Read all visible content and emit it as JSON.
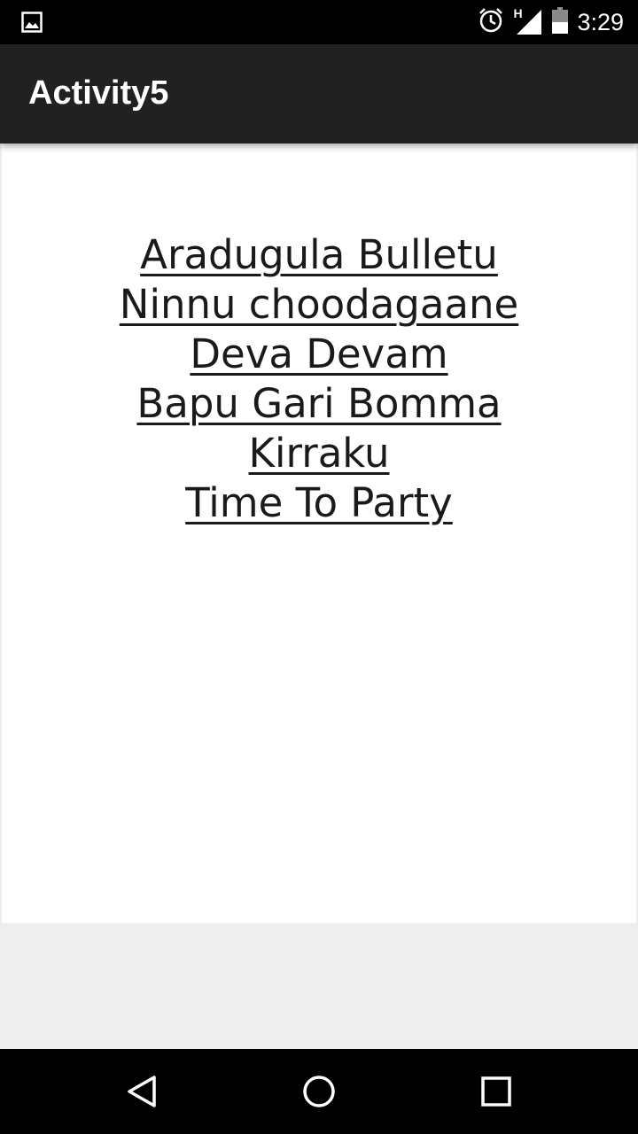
{
  "status_bar": {
    "time": "3:29",
    "network_label": "H",
    "icons": [
      "image-notification-icon",
      "alarm-icon",
      "signal-icon",
      "battery-icon"
    ]
  },
  "app_bar": {
    "title": "Activity5"
  },
  "songs": [
    "Aradugula Bulletu",
    "Ninnu choodagaane",
    "Deva Devam",
    "Bapu Gari Bomma",
    "Kirraku",
    "Time To Party"
  ],
  "nav_bar": {
    "icons": [
      "back-icon",
      "home-icon",
      "recents-icon"
    ]
  },
  "colors": {
    "status_bar": "#000000",
    "app_bar": "#212121",
    "content_bg": "#ffffff",
    "window_bg": "#eeeeee",
    "link_text": "#1a1a1a"
  }
}
